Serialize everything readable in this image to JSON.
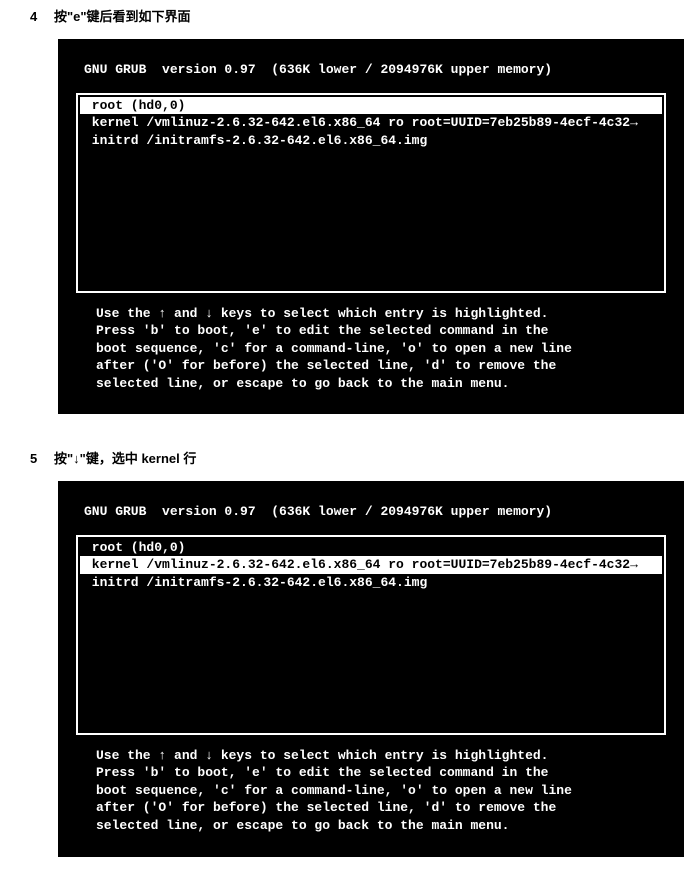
{
  "step4": {
    "num": "4",
    "text": "按\"e\"键后看到如下界面"
  },
  "step5": {
    "num": "5",
    "text": "按\"↓\"键，选中 kernel 行"
  },
  "grub": {
    "header": "GNU GRUB  version 0.97  (636K lower / 2094976K upper memory)",
    "lines": {
      "root": " root (hd0,0)",
      "kernel": " kernel /vmlinuz-2.6.32-642.el6.x86_64 ro root=UUID=7eb25b89-4ecf-4c32→",
      "initrd": " initrd /initramfs-2.6.32-642.el6.x86_64.img"
    },
    "help": "Use the ↑ and ↓ keys to select which entry is highlighted.\nPress 'b' to boot, 'e' to edit the selected command in the\nboot sequence, 'c' for a command-line, 'o' to open a new line\nafter ('O' for before) the selected line, 'd' to remove the\nselected line, or escape to go back to the main menu."
  }
}
